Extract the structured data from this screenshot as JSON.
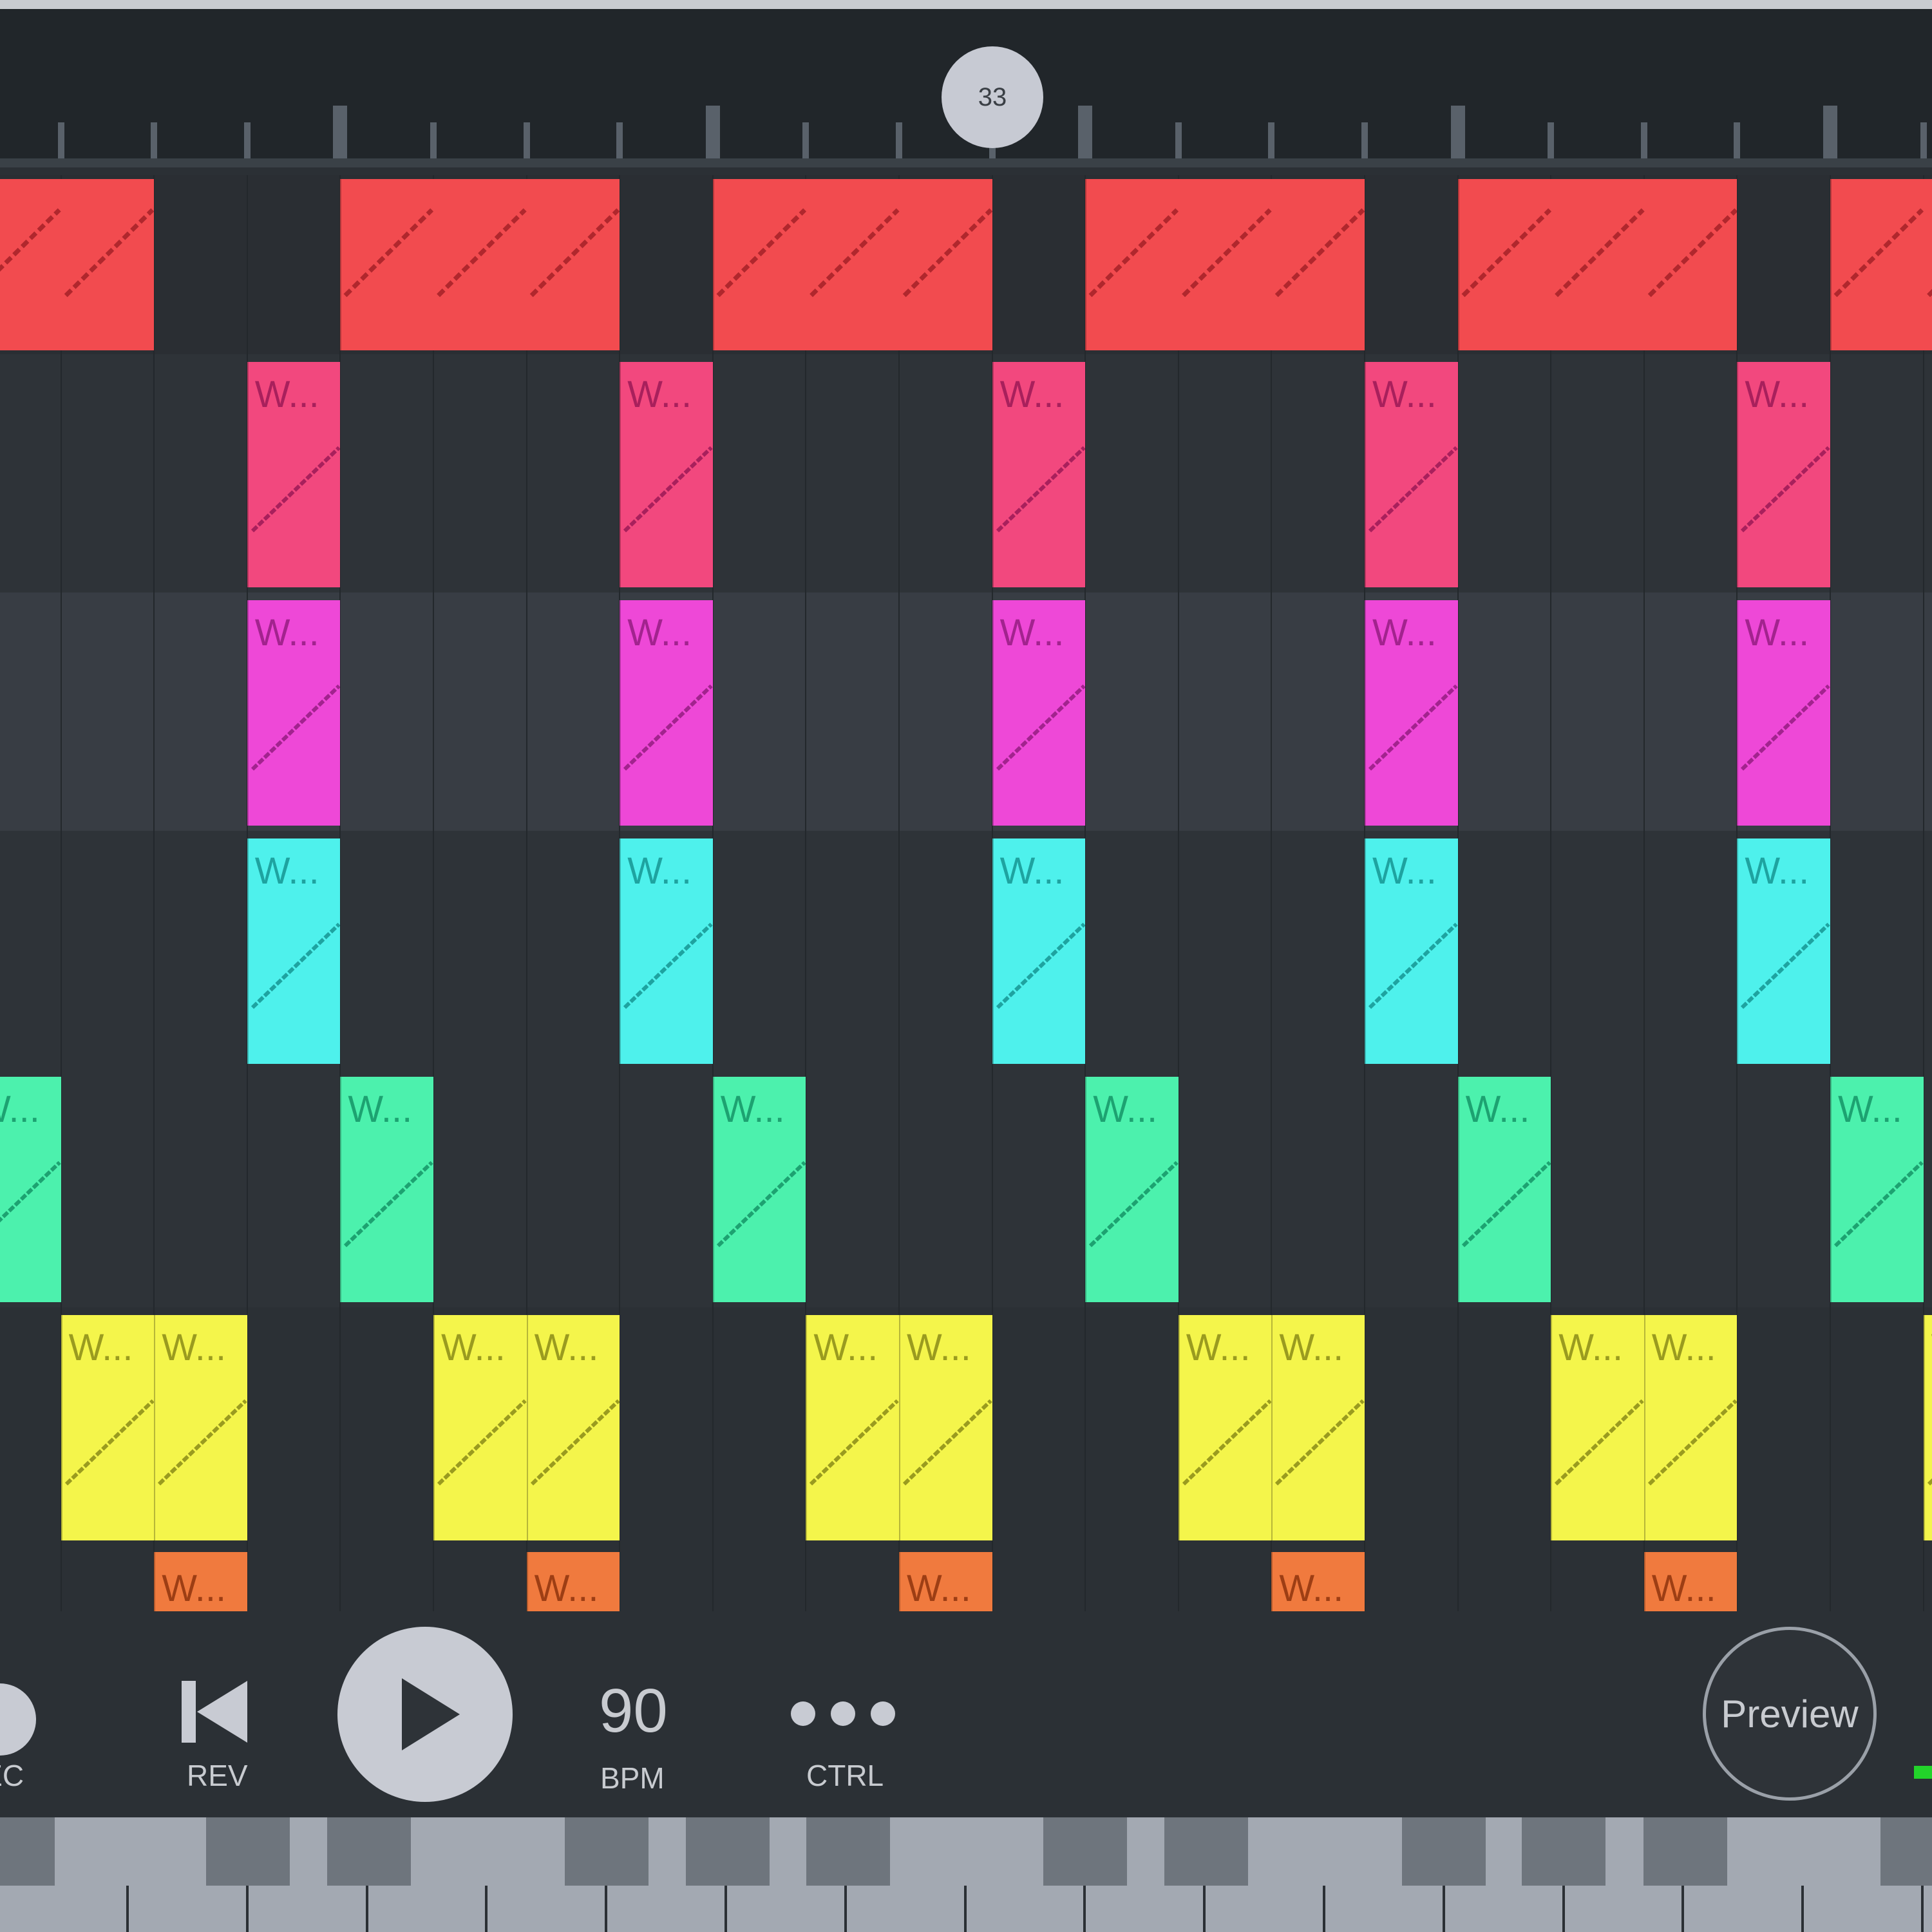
{
  "timeline": {
    "playhead_label": "33"
  },
  "clip_label": "W...",
  "transport": {
    "rec_label": "REC",
    "rev_label": "REV",
    "bpm_value": "90",
    "bpm_label": "BPM",
    "ctrl_label": "CTRL",
    "preview_label": "Preview"
  },
  "colors": {
    "lane_red": "#f24b4f",
    "lane_pink": "#f2487e",
    "lane_magenta": "#ee48d7",
    "lane_cyan": "#4ef1ec",
    "lane_green": "#4cf1ad",
    "lane_yellow": "#f4f54b",
    "lane_orange": "#f07a3e"
  },
  "icons": [
    "rec-icon",
    "skip-back-icon",
    "play-icon",
    "more-dots-icon"
  ]
}
